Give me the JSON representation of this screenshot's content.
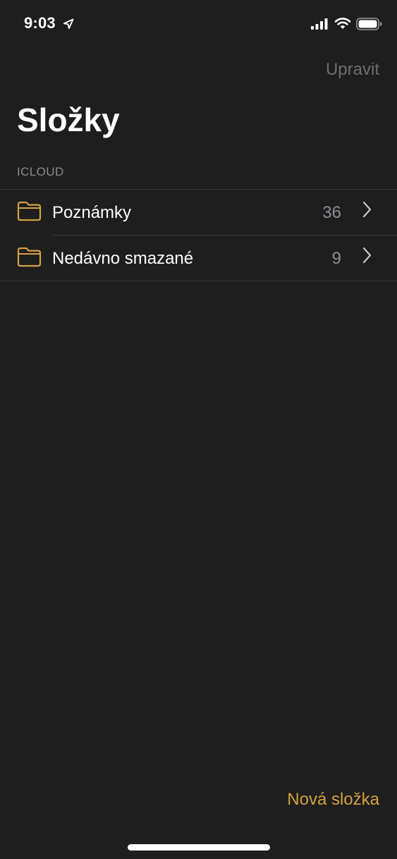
{
  "status_bar": {
    "time": "9:03",
    "icons": [
      "location-arrow-icon",
      "cellular-signal-icon",
      "wifi-icon",
      "battery-icon"
    ]
  },
  "nav": {
    "edit_label": "Upravit"
  },
  "title": "Složky",
  "section": {
    "header": "ICLOUD",
    "folders": [
      {
        "name": "Poznámky",
        "count": "36",
        "icon": "folder-icon"
      },
      {
        "name": "Nedávno smazané",
        "count": "9",
        "icon": "folder-icon"
      }
    ]
  },
  "toolbar": {
    "new_folder_label": "Nová složka"
  },
  "colors": {
    "background": "#1e1e1f",
    "accent": "#d4a23f",
    "secondary_text": "#8e8e93",
    "disabled_text": "#6e6e71",
    "separator": "#38383a"
  }
}
